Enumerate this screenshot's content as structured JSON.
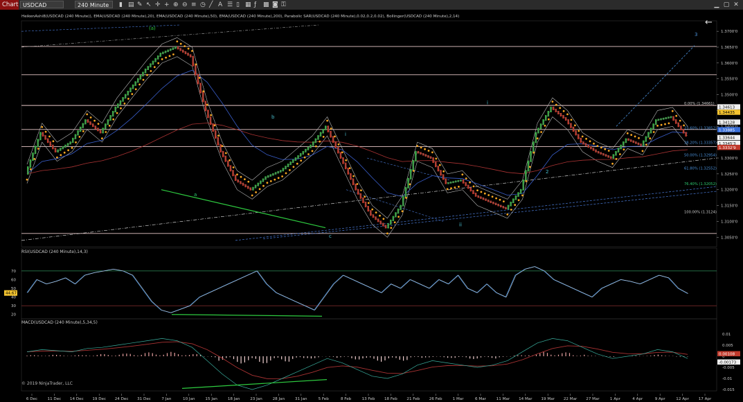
{
  "toolbar": {
    "tab": "Chart",
    "instrument": "USDCAD",
    "interval": "240 Minute",
    "icons": [
      "bars-icon",
      "chart-style-icon",
      "pencil-icon",
      "cursor-icon",
      "crosshair-icon",
      "plus-icon",
      "zoom-in-icon",
      "zoom-out-icon",
      "properties-icon",
      "clock-icon",
      "lines-icon",
      "text-icon",
      "list-icon",
      "file-icon",
      "calendar-icon",
      "fx-icon",
      "grid-icon",
      "camera-icon",
      "lock-icon"
    ],
    "window_buttons": [
      "minimize-icon",
      "maximize-icon",
      "close-icon"
    ]
  },
  "chart_data": [
    {
      "type": "line",
      "title": "HeikenAshi8(USDCAD (240 Minute)), EMA(USDCAD (240 Minute),20), EMA(USDCAD (240 Minute),50), EMA(USDCAD (240 Minute),200), Parabolic SAR(USDCAD (240 Minute),0.02,0.2,0.02), Bollinger(USDCAD (240 Minute),2,14)",
      "ylim": [
        1.302,
        1.372
      ],
      "yticks": [
        "1.3050'0",
        "1.3100'0",
        "1.3150'0",
        "1.3200'0",
        "1.3250'0",
        "1.3300'0",
        "1.3350'0",
        "1.3400'0",
        "1.3450'0",
        "1.3500'0",
        "1.3550'0",
        "1.3600'0",
        "1.3650'0",
        "1.3700'0"
      ],
      "series": [
        {
          "values": [
            1.325,
            1.338,
            1.332,
            1.335,
            1.342,
            1.338,
            1.346,
            1.352,
            1.358,
            1.363,
            1.365,
            1.362,
            1.345,
            1.332,
            1.323,
            1.32,
            1.324,
            1.326,
            1.33,
            1.334,
            1.34,
            1.33,
            1.32,
            1.312,
            1.308,
            1.315,
            1.332,
            1.33,
            1.322,
            1.323,
            1.318,
            1.316,
            1.314,
            1.32,
            1.338,
            1.346,
            1.342,
            1.335,
            1.332,
            1.33,
            1.336,
            1.334,
            1.342,
            1.343,
            1.337
          ]
        }
      ],
      "horizontal_levels": [
        1.3652,
        1.3563,
        1.3466,
        1.339,
        1.3336,
        1.3062
      ],
      "price_labels": [
        {
          "text": "1.34613",
          "value": 1.3461,
          "color": "#111",
          "bg": "#f0f0f0"
        },
        {
          "text": "1.34435",
          "value": 1.3444,
          "color": "#000",
          "bg": "#f4c430"
        },
        {
          "text": "1.34128",
          "value": 1.3413,
          "color": "#111",
          "bg": "#f0f0f0"
        },
        {
          "text": "1.33885",
          "value": 1.3389,
          "color": "#fff",
          "bg": "#3a6fd8"
        },
        {
          "text": "1.33644",
          "value": 1.3364,
          "color": "#111",
          "bg": "#f0f0f0"
        },
        {
          "text": "1.3345'3",
          "value": 1.3346,
          "color": "#111",
          "bg": "#f0f0f0"
        },
        {
          "text": "1.3332'9",
          "value": 1.3333,
          "color": "#fff",
          "bg": "#c0392b"
        }
      ],
      "fib_labels": [
        {
          "text": "0.00% (1.34661)",
          "value": 1.3466,
          "color": "#cccccc"
        },
        {
          "text": "23.60% (1.33852)",
          "value": 1.3389,
          "color": "#4a90d9"
        },
        {
          "text": "38.20% (1.33357)",
          "value": 1.3343,
          "color": "#4a90d9"
        },
        {
          "text": "50.00% (1.32954)",
          "value": 1.3303,
          "color": "#4a90d9"
        },
        {
          "text": "61.80% (1.32552)",
          "value": 1.3262,
          "color": "#4a90d9"
        },
        {
          "text": "76.40% (1.32052)",
          "value": 1.3212,
          "color": "#2ecc71"
        },
        {
          "text": "100.00% (1.3124)",
          "value": 1.3124,
          "color": "#cccccc"
        }
      ],
      "wave_labels": [
        "(a)",
        "a",
        "b",
        "c",
        "i",
        "ii",
        "i",
        "2",
        "3"
      ]
    },
    {
      "type": "line",
      "title": "RSI(USDCAD (240 Minute),14,3)",
      "ylim": [
        15,
        85
      ],
      "yticks": [
        "70",
        "60",
        "50",
        "40",
        "30",
        "20"
      ],
      "levels": [
        70,
        30
      ],
      "current_label": "44.67",
      "series": [
        {
          "values": [
            45,
            60,
            55,
            58,
            62,
            55,
            65,
            68,
            70,
            72,
            70,
            65,
            50,
            35,
            25,
            22,
            26,
            30,
            40,
            45,
            50,
            55,
            60,
            65,
            70,
            55,
            45,
            40,
            35,
            30,
            25,
            40,
            55,
            65,
            60,
            55,
            50,
            45,
            55,
            50,
            60,
            55,
            50,
            60,
            55,
            65,
            50,
            45,
            55,
            45,
            40,
            65,
            72,
            75,
            70,
            60,
            55,
            50,
            45,
            40,
            50,
            55,
            60,
            58,
            55,
            60,
            65,
            62,
            50,
            44
          ]
        }
      ]
    },
    {
      "type": "bar",
      "title": "MACD(USDCAD (240 Minute),5,34,5)",
      "ylim": [
        -0.0175,
        0.0125
      ],
      "yticks": [
        "0.01",
        "0.005",
        "0",
        "-0.005",
        "-0.01",
        "-0.015"
      ],
      "current_labels": [
        "0.00108",
        "-0.00173"
      ],
      "series": [
        {
          "values": [
            0.002,
            0.003,
            0.0025,
            0.002,
            0.0035,
            0.004,
            0.005,
            0.006,
            0.007,
            0.008,
            0.007,
            0.004,
            -0.002,
            -0.008,
            -0.013,
            -0.015,
            -0.013,
            -0.01,
            -0.007,
            -0.004,
            -0.001,
            -0.003,
            -0.006,
            -0.009,
            -0.01,
            -0.008,
            -0.004,
            -0.002,
            -0.003,
            -0.004,
            -0.005,
            -0.004,
            -0.002,
            0.002,
            0.006,
            0.008,
            0.007,
            0.004,
            0.001,
            -0.001,
            0.0,
            0.001,
            0.003,
            0.002,
            -0.001
          ]
        }
      ]
    }
  ],
  "x_axis": {
    "ticks": [
      "6 Dec",
      "11 Dec",
      "14 Dec",
      "19 Dec",
      "24 Dec",
      "31 Dec",
      "7 Jan",
      "10 Jan",
      "15 Jan",
      "18 Jan",
      "23 Jan",
      "28 Jan",
      "31 Jan",
      "5 Feb",
      "8 Feb",
      "13 Feb",
      "18 Feb",
      "21 Feb",
      "26 Feb",
      "1 Mar",
      "6 Mar",
      "11 Mar",
      "14 Mar",
      "19 Mar",
      "22 Mar",
      "27 Mar",
      "1 Apr",
      "4 Apr",
      "9 Apr",
      "12 Apr",
      "17 Apr"
    ]
  },
  "copyright": "© 2019 NinjaTrader, LLC"
}
